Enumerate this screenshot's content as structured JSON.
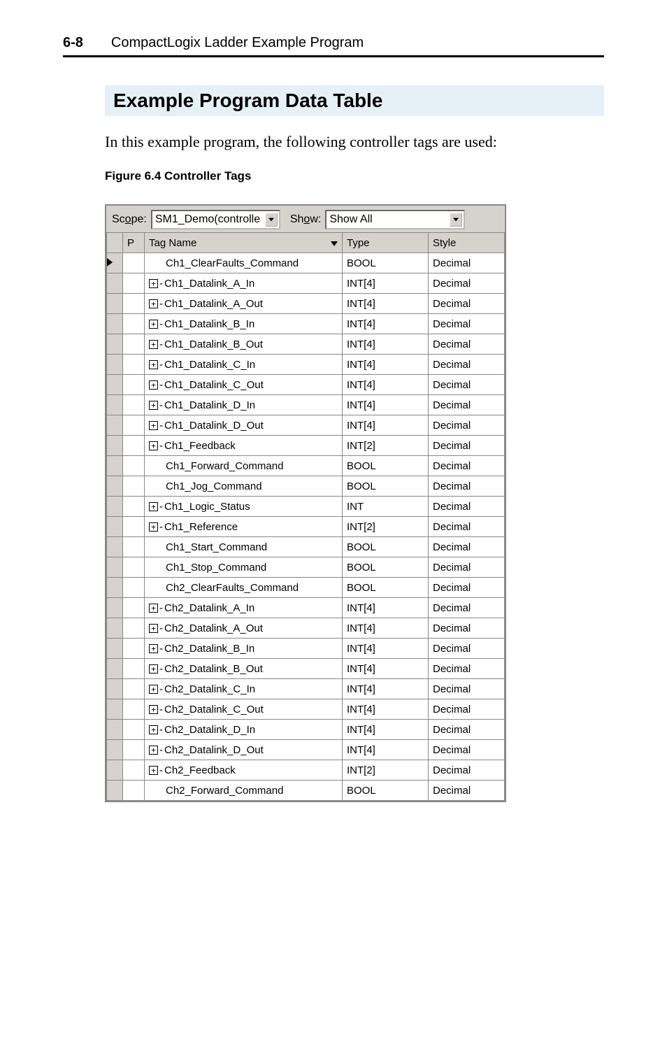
{
  "header": {
    "page_number": "6-8",
    "title": "CompactLogix Ladder Example Program"
  },
  "section_title": "Example Program Data Table",
  "intro_text": "In this example program, the following controller tags are used:",
  "figure_caption": "Figure 6.4   Controller Tags",
  "controls": {
    "scope_label_pre": "Sc",
    "scope_label_u": "o",
    "scope_label_post": "pe:",
    "scope_value": "SM1_Demo(controlle",
    "show_label_pre": "Sh",
    "show_label_u": "o",
    "show_label_post": "w:",
    "show_value": "Show All"
  },
  "columns": {
    "p": "P",
    "tag": "Tag Name",
    "type": "Type",
    "style": "Style"
  },
  "rows": [
    {
      "selected": true,
      "expandable": false,
      "name": "Ch1_ClearFaults_Command",
      "type": "BOOL",
      "style": "Decimal"
    },
    {
      "selected": false,
      "expandable": true,
      "name": "Ch1_Datalink_A_In",
      "type": "INT[4]",
      "style": "Decimal"
    },
    {
      "selected": false,
      "expandable": true,
      "name": "Ch1_Datalink_A_Out",
      "type": "INT[4]",
      "style": "Decimal"
    },
    {
      "selected": false,
      "expandable": true,
      "name": "Ch1_Datalink_B_In",
      "type": "INT[4]",
      "style": "Decimal"
    },
    {
      "selected": false,
      "expandable": true,
      "name": "Ch1_Datalink_B_Out",
      "type": "INT[4]",
      "style": "Decimal"
    },
    {
      "selected": false,
      "expandable": true,
      "name": "Ch1_Datalink_C_In",
      "type": "INT[4]",
      "style": "Decimal"
    },
    {
      "selected": false,
      "expandable": true,
      "name": "Ch1_Datalink_C_Out",
      "type": "INT[4]",
      "style": "Decimal"
    },
    {
      "selected": false,
      "expandable": true,
      "name": "Ch1_Datalink_D_In",
      "type": "INT[4]",
      "style": "Decimal"
    },
    {
      "selected": false,
      "expandable": true,
      "name": "Ch1_Datalink_D_Out",
      "type": "INT[4]",
      "style": "Decimal"
    },
    {
      "selected": false,
      "expandable": true,
      "name": "Ch1_Feedback",
      "type": "INT[2]",
      "style": "Decimal"
    },
    {
      "selected": false,
      "expandable": false,
      "name": "Ch1_Forward_Command",
      "type": "BOOL",
      "style": "Decimal"
    },
    {
      "selected": false,
      "expandable": false,
      "name": "Ch1_Jog_Command",
      "type": "BOOL",
      "style": "Decimal"
    },
    {
      "selected": false,
      "expandable": true,
      "name": "Ch1_Logic_Status",
      "type": "INT",
      "style": "Decimal"
    },
    {
      "selected": false,
      "expandable": true,
      "name": "Ch1_Reference",
      "type": "INT[2]",
      "style": "Decimal"
    },
    {
      "selected": false,
      "expandable": false,
      "name": "Ch1_Start_Command",
      "type": "BOOL",
      "style": "Decimal"
    },
    {
      "selected": false,
      "expandable": false,
      "name": "Ch1_Stop_Command",
      "type": "BOOL",
      "style": "Decimal"
    },
    {
      "selected": false,
      "expandable": false,
      "name": "Ch2_ClearFaults_Command",
      "type": "BOOL",
      "style": "Decimal"
    },
    {
      "selected": false,
      "expandable": true,
      "name": "Ch2_Datalink_A_In",
      "type": "INT[4]",
      "style": "Decimal"
    },
    {
      "selected": false,
      "expandable": true,
      "name": "Ch2_Datalink_A_Out",
      "type": "INT[4]",
      "style": "Decimal"
    },
    {
      "selected": false,
      "expandable": true,
      "name": "Ch2_Datalink_B_In",
      "type": "INT[4]",
      "style": "Decimal"
    },
    {
      "selected": false,
      "expandable": true,
      "name": "Ch2_Datalink_B_Out",
      "type": "INT[4]",
      "style": "Decimal"
    },
    {
      "selected": false,
      "expandable": true,
      "name": "Ch2_Datalink_C_In",
      "type": "INT[4]",
      "style": "Decimal"
    },
    {
      "selected": false,
      "expandable": true,
      "name": "Ch2_Datalink_C_Out",
      "type": "INT[4]",
      "style": "Decimal"
    },
    {
      "selected": false,
      "expandable": true,
      "name": "Ch2_Datalink_D_In",
      "type": "INT[4]",
      "style": "Decimal"
    },
    {
      "selected": false,
      "expandable": true,
      "name": "Ch2_Datalink_D_Out",
      "type": "INT[4]",
      "style": "Decimal"
    },
    {
      "selected": false,
      "expandable": true,
      "name": "Ch2_Feedback",
      "type": "INT[2]",
      "style": "Decimal"
    },
    {
      "selected": false,
      "expandable": false,
      "name": "Ch2_Forward_Command",
      "type": "BOOL",
      "style": "Decimal"
    }
  ]
}
